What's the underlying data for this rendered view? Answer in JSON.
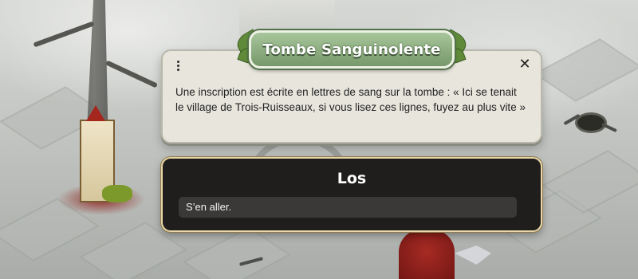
{
  "dialog": {
    "title": "Tombe Sanguinolente",
    "close_icon": "close-icon",
    "menu_icon": "vertical-ellipsis-icon",
    "description": "Une inscription est écrite en lettres de sang sur la tombe : « Ici se tenait le village de Trois-Ruisseaux, si vous lisez ces lignes, fuyez au plus vite »",
    "close_glyph": "✕"
  },
  "choice": {
    "title": "Los",
    "options": [
      {
        "label": "S’en aller."
      }
    ]
  },
  "colors": {
    "info_panel_bg": "#e7e5dc",
    "title_plate": "#8fb183",
    "choice_panel_bg": "#1f1e1d",
    "choice_border": "#e8d6a6",
    "option_bg": "#3a3938"
  }
}
